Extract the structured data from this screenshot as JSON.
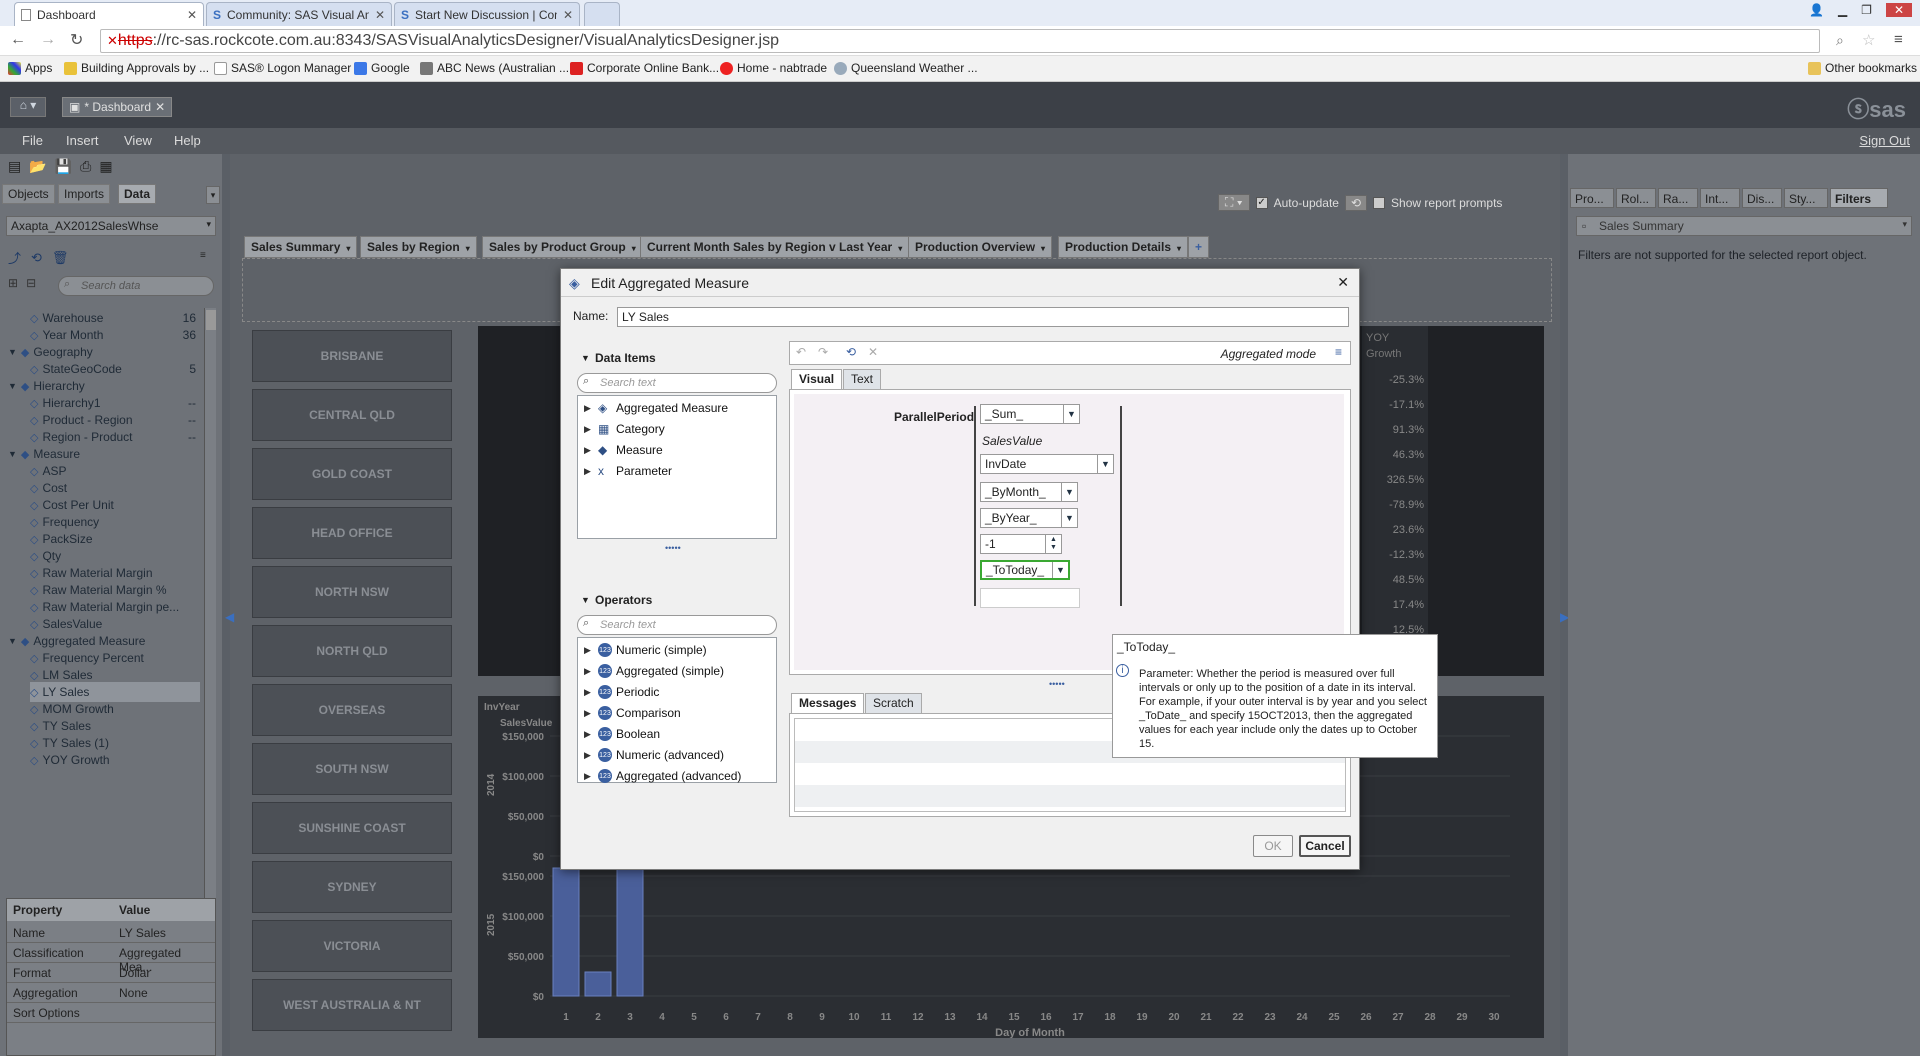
{
  "browser": {
    "tabs": [
      {
        "title": "Dashboard"
      },
      {
        "title": "Community: SAS Visual Analy"
      },
      {
        "title": "Start New Discussion | Comm"
      }
    ],
    "url": {
      "scheme": "https",
      "rest": "://rc-sas.rockcote.com.au:8343/SASVisualAnalyticsDesigner/VisualAnalyticsDesigner.jsp"
    },
    "bookmarks": [
      "Apps",
      "Building Approvals by ...",
      "SAS® Logon Manager",
      "Google",
      "ABC News (Australian ...",
      "Corporate Online Bank...",
      "Home - nabtrade",
      "Queensland Weather ...",
      "Other bookmarks"
    ]
  },
  "app": {
    "doc_tab": "* Dashboard",
    "logo": "sas",
    "menu": [
      "File",
      "Insert",
      "View",
      "Help"
    ],
    "signout": "Sign Out",
    "left_tabs": [
      "Objects",
      "Imports",
      "Data"
    ],
    "datasource": "Axapta_AX2012SalesWhse",
    "search_data_placeholder": "Search data",
    "tree": [
      {
        "label": "Warehouse",
        "count": "16",
        "level": 2
      },
      {
        "label": "Year Month",
        "count": "36",
        "level": 2
      },
      {
        "label": "Geography",
        "count": "",
        "level": 1
      },
      {
        "label": "StateGeoCode",
        "count": "5",
        "level": 2
      },
      {
        "label": "Hierarchy",
        "count": "",
        "level": 1
      },
      {
        "label": "Hierarchy1",
        "count": "--",
        "level": 2
      },
      {
        "label": "Product - Region",
        "count": "--",
        "level": 2
      },
      {
        "label": "Region - Product",
        "count": "--",
        "level": 2
      },
      {
        "label": "Measure",
        "count": "",
        "level": 1
      },
      {
        "label": "ASP",
        "count": "",
        "level": 2
      },
      {
        "label": "Cost",
        "count": "",
        "level": 2
      },
      {
        "label": "Cost Per Unit",
        "count": "",
        "level": 2
      },
      {
        "label": "Frequency",
        "count": "",
        "level": 2
      },
      {
        "label": "PackSize",
        "count": "",
        "level": 2
      },
      {
        "label": "Qty",
        "count": "",
        "level": 2
      },
      {
        "label": "Raw Material Margin",
        "count": "",
        "level": 2
      },
      {
        "label": "Raw Material Margin %",
        "count": "",
        "level": 2
      },
      {
        "label": "Raw Material Margin pe...",
        "count": "",
        "level": 2
      },
      {
        "label": "SalesValue",
        "count": "",
        "level": 2
      },
      {
        "label": "Aggregated Measure",
        "count": "",
        "level": 1
      },
      {
        "label": "Frequency Percent",
        "count": "",
        "level": 2
      },
      {
        "label": "LM Sales",
        "count": "",
        "level": 2
      },
      {
        "label": "LY Sales",
        "count": "",
        "level": 2
      },
      {
        "label": "MOM Growth",
        "count": "",
        "level": 2
      },
      {
        "label": "TY Sales",
        "count": "",
        "level": 2
      },
      {
        "label": "TY Sales (1)",
        "count": "",
        "level": 2
      },
      {
        "label": "YOY Growth",
        "count": "",
        "level": 2
      }
    ],
    "props_header": [
      "Property",
      "Value"
    ],
    "props": [
      {
        "k": "Name",
        "v": "LY Sales"
      },
      {
        "k": "Classification",
        "v": "Aggregated Mea..."
      },
      {
        "k": "Format",
        "v": "Dollar"
      },
      {
        "k": "Aggregation",
        "v": "None"
      },
      {
        "k": "Sort Options",
        "v": ""
      }
    ],
    "auto_update": "Auto-update",
    "show_prompts": "Show report prompts",
    "report_tabs": [
      "Sales Summary",
      "Sales by Region",
      "Sales by Product Group",
      "Current Month Sales by Region v Last Year",
      "Production Overview",
      "Production Details"
    ],
    "regions": [
      "BRISBANE",
      "CENTRAL QLD",
      "GOLD COAST",
      "HEAD OFFICE",
      "NORTH NSW",
      "NORTH QLD",
      "OVERSEAS",
      "SOUTH NSW",
      "SUNSHINE COAST",
      "SYDNEY",
      "VICTORIA",
      "WEST AUSTRALIA & NT"
    ],
    "yoy_header": [
      "YOY",
      "Growth"
    ],
    "yoy_values": [
      "-25.3%",
      "-17.1%",
      "91.3%",
      "46.3%",
      "326.5%",
      "-78.9%",
      "23.6%",
      "-12.3%",
      "48.5%",
      "17.4%",
      "12.5%"
    ],
    "right_tabs": [
      "Pro...",
      "Rol...",
      "Ra...",
      "Int...",
      "Dis...",
      "Sty...",
      "Filters"
    ],
    "right_select": "Sales Summary",
    "filters_msg": "Filters are not supported for the selected report object."
  },
  "dialog": {
    "title": "Edit Aggregated Measure",
    "name_label": "Name:",
    "name_value": "LY Sales",
    "data_items_title": "Data Items",
    "search_placeholder": "Search text",
    "data_items": [
      "Aggregated Measure",
      "Category",
      "Measure",
      "Parameter"
    ],
    "operators_title": "Operators",
    "operators": [
      "Numeric (simple)",
      "Aggregated (simple)",
      "Periodic",
      "Comparison",
      "Boolean",
      "Numeric (advanced)",
      "Aggregated (advanced)"
    ],
    "mode": "Aggregated mode",
    "tabs": [
      "Visual",
      "Text"
    ],
    "fn_label": "ParallelPeriod",
    "agg": "_Sum_",
    "measure": "SalesValue",
    "date": "InvDate",
    "inner": "_ByMonth_",
    "outer": "_ByYear_",
    "offset": "-1",
    "totoday": "_ToToday_",
    "msg_tabs": [
      "Messages",
      "Scratch"
    ],
    "ok": "OK",
    "cancel": "Cancel"
  },
  "tooltip": {
    "title": "_ToToday_",
    "body": "Parameter: Whether the period is measured over full intervals or only up to the position of a date in its interval.  For example, if your outer interval is by year and you select _ToDate_ and specify 15OCT2013, then the aggregated values for each year include only the dates up to October 15."
  },
  "chart_data": {
    "type": "bar",
    "title": "",
    "xlabel": "Day of Month",
    "ylabel": "InvYear / SalesValue",
    "x": [
      1,
      2,
      3,
      4,
      5,
      6,
      7,
      8,
      9,
      10,
      11,
      12,
      13,
      14,
      15,
      16,
      17,
      18,
      19,
      20,
      21,
      22,
      23,
      24,
      25,
      26,
      27,
      28,
      29,
      30
    ],
    "series": [
      {
        "name": "2015",
        "values": [
          160000,
          30000,
          160000,
          0,
          0,
          0,
          0,
          0,
          0,
          0,
          0,
          0,
          0,
          0,
          0,
          0,
          0,
          0,
          0,
          0,
          0,
          0,
          0,
          0,
          0,
          0,
          0,
          0,
          0,
          0
        ]
      }
    ],
    "y_ticks": [
      "$150,000",
      "$100,000",
      "$50,000",
      "$0"
    ],
    "panels": [
      "2014",
      "2015"
    ],
    "ylim": [
      0,
      170000
    ]
  },
  "colors": {
    "accent": "#3a5fa0",
    "focus": "#3aa832"
  }
}
